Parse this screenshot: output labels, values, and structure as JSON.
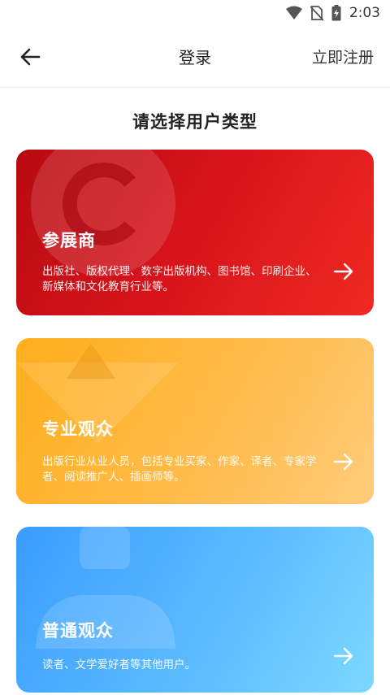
{
  "status_bar": {
    "time": "2:03",
    "icons": [
      "wifi-icon",
      "no-sim-icon",
      "battery-charging-icon"
    ]
  },
  "app_bar": {
    "back_icon": "arrow-left-icon",
    "title": "登录",
    "register_label": "立即注册"
  },
  "section_title": "请选择用户类型",
  "cards": [
    {
      "title": "参展商",
      "description": "出版社、版权代理、数字出版机构、图书馆、印刷企业、新媒体和文化教育行业等。",
      "icon": "arrow-right-icon",
      "color": "#d8141b"
    },
    {
      "title": "专业观众",
      "description": "出版行业从业人员，包括专业买家、作家、译者、专家学者、阅读推广人、插画师等。",
      "icon": "arrow-right-icon",
      "color": "#ffb534"
    },
    {
      "title": "普通观众",
      "description": "读者、文学爱好者等其他用户。",
      "icon": "arrow-right-icon",
      "color": "#4aabff"
    }
  ]
}
